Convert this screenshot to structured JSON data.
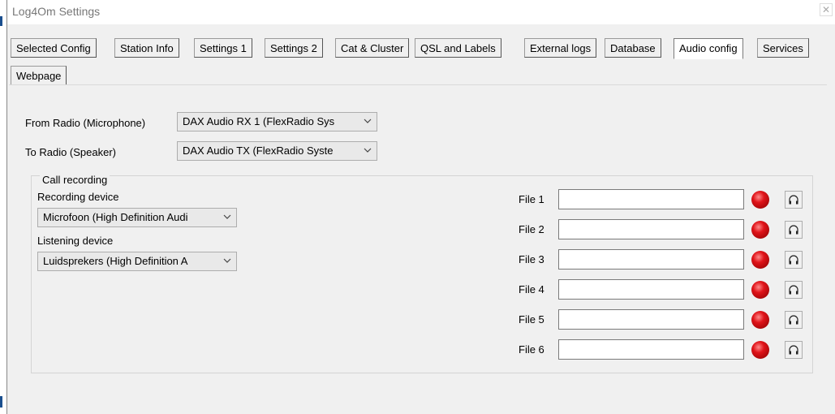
{
  "window": {
    "title": "Log4Om Settings"
  },
  "tabs": [
    {
      "label": "Selected Config"
    },
    {
      "label": "Station Info"
    },
    {
      "label": "Settings 1"
    },
    {
      "label": "Settings 2"
    },
    {
      "label": "Cat & Cluster"
    },
    {
      "label": "QSL and Labels"
    },
    {
      "label": "External logs"
    },
    {
      "label": "Database"
    },
    {
      "label": "Audio config",
      "active": true
    },
    {
      "label": "Services"
    },
    {
      "label": "Webpage"
    }
  ],
  "audio": {
    "from_radio_label": "From Radio (Microphone)",
    "from_radio_value": "DAX Audio RX 1 (FlexRadio Sys",
    "to_radio_label": "To Radio (Speaker)",
    "to_radio_value": "DAX Audio TX (FlexRadio Syste"
  },
  "call_recording": {
    "legend": "Call recording",
    "recording_label": "Recording device",
    "recording_value": "Microfoon (High Definition Audi",
    "listening_label": "Listening device",
    "listening_value": "Luidsprekers (High Definition A",
    "files": [
      {
        "label": "File 1",
        "value": ""
      },
      {
        "label": "File 2",
        "value": ""
      },
      {
        "label": "File 3",
        "value": ""
      },
      {
        "label": "File 4",
        "value": ""
      },
      {
        "label": "File 5",
        "value": ""
      },
      {
        "label": "File 6",
        "value": ""
      }
    ]
  },
  "icons": {
    "record": "record-icon",
    "play": "headphones-icon",
    "dropdown": "chevron-down-icon"
  },
  "colors": {
    "record_red": "#e0141a",
    "window_bg": "#f0f0f0"
  }
}
